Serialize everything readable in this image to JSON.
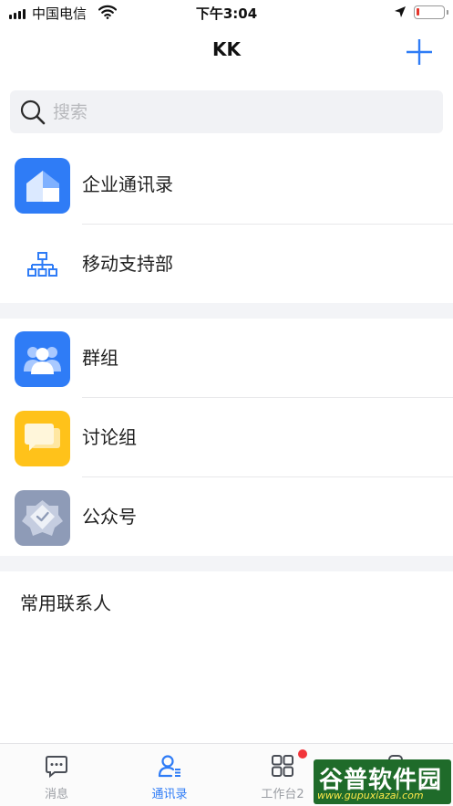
{
  "status_bar": {
    "carrier": "中国电信",
    "time": "下午3:04",
    "battery_level": 0.1
  },
  "nav": {
    "title": "KK",
    "add_icon": "plus-icon"
  },
  "search": {
    "placeholder": "搜索",
    "icon": "search-icon"
  },
  "org_section": [
    {
      "label": "企业通讯录",
      "icon": "building-icon",
      "color": "#2f7cf6"
    },
    {
      "label": "移动支持部",
      "icon": "org-chart-icon",
      "color": "#2f7cf6"
    }
  ],
  "group_section": [
    {
      "label": "群组",
      "icon": "people-icon",
      "color": "#2f7cf6"
    },
    {
      "label": "讨论组",
      "icon": "chat-bubbles-icon",
      "color": "#ffc21a"
    },
    {
      "label": "公众号",
      "icon": "verified-badge-icon",
      "color": "#8e9bb7"
    }
  ],
  "frequent_contacts": {
    "title": "常用联系人"
  },
  "tabbar": {
    "active": "通讯录",
    "tabs": [
      {
        "label": "消息",
        "icon": "message-icon"
      },
      {
        "label": "通讯录",
        "icon": "contacts-icon"
      },
      {
        "label": "工作台2",
        "icon": "workbench-icon"
      },
      {
        "label": "",
        "icon": "profile-icon"
      }
    ]
  },
  "watermark": {
    "title": "谷普软件园",
    "url": "www.gupuxiazai.com"
  }
}
